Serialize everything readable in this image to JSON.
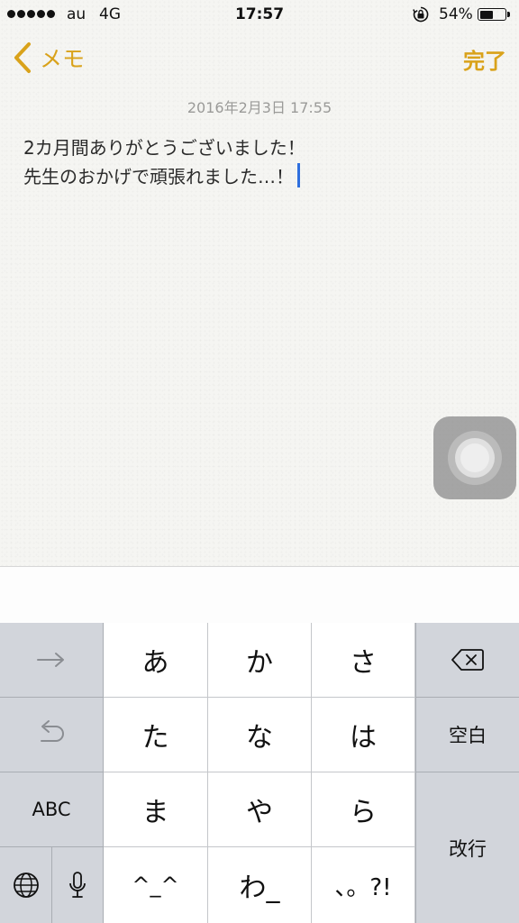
{
  "status_bar": {
    "carrier": "au",
    "network": "4G",
    "time": "17:57",
    "battery_percent": "54%",
    "battery_level": 0.54
  },
  "nav": {
    "back_label": "メモ",
    "done_label": "完了"
  },
  "note": {
    "date": "2016年2月3日 17:55",
    "lines": [
      "2カ月間ありがとうございました！",
      "先生のおかげで頑張れました…！"
    ]
  },
  "keyboard": {
    "keys": {
      "a": "あ",
      "ka": "か",
      "sa": "さ",
      "ta": "た",
      "na": "な",
      "ha": "は",
      "ma": "ま",
      "ya": "や",
      "ra": "ら",
      "kaomoji": "^_^",
      "wa": "わ_",
      "punct": "、。?!",
      "abc": "ABC",
      "space": "空白",
      "return": "改行"
    },
    "icons": {
      "next": "arrow-right-icon",
      "undo": "undo-icon",
      "delete": "backspace-icon",
      "globe": "globe-icon",
      "mic": "microphone-icon"
    }
  },
  "colors": {
    "accent": "#d9a21a",
    "caret": "#2f6fde",
    "paper": "#f5f5f2",
    "keyboard_bg": "#bfc3c9",
    "key_main": "#ffffff",
    "key_func": "#d2d5db"
  }
}
